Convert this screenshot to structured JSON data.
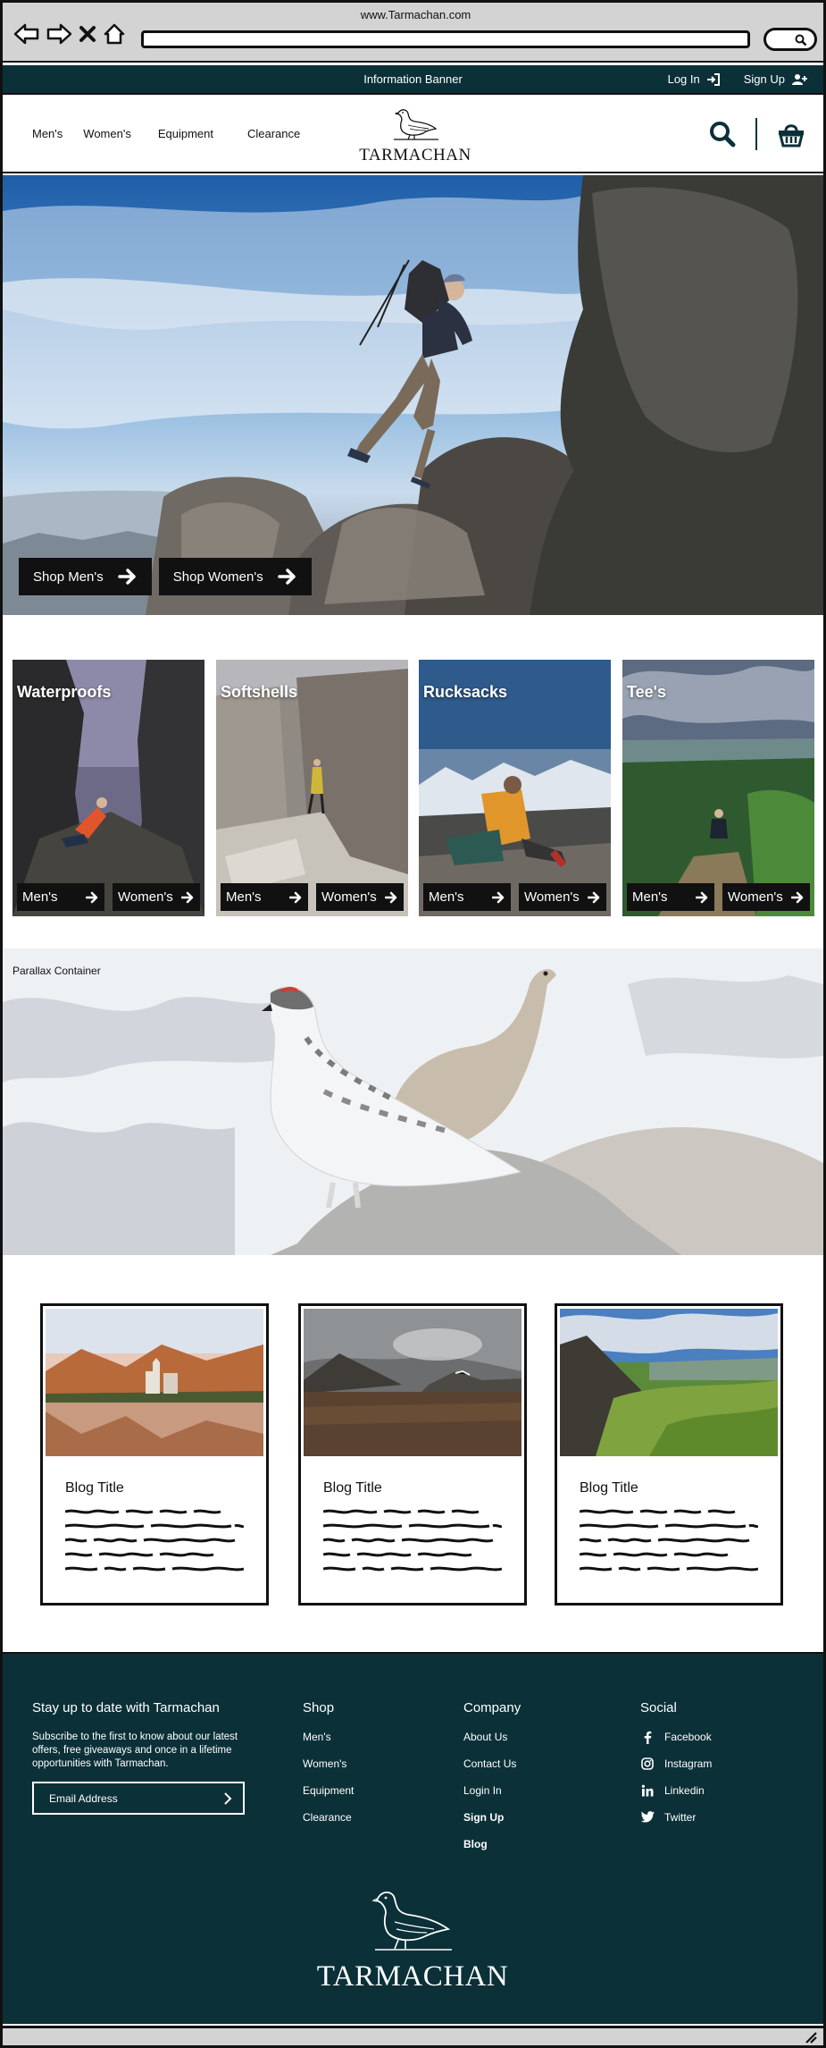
{
  "browser": {
    "url": "www.Tarmachan.com"
  },
  "banner": {
    "text": "Information Banner",
    "login": "Log In",
    "signup": "Sign Up"
  },
  "nav": {
    "mens": "Men's",
    "womens": "Women's",
    "equipment": "Equipment",
    "clearance": "Clearance"
  },
  "brand": {
    "name": "TARMACHAN"
  },
  "hero": {
    "shop_mens": "Shop Men's",
    "shop_womens": "Shop Women's"
  },
  "categories": [
    {
      "title": "Waterproofs",
      "mens": "Men's",
      "womens": "Women's"
    },
    {
      "title": "Softshells",
      "mens": "Men's",
      "womens": "Women's"
    },
    {
      "title": "Rucksacks",
      "mens": "Men's",
      "womens": "Women's"
    },
    {
      "title": "Tee's",
      "mens": "Men's",
      "womens": "Women's"
    }
  ],
  "parallax": {
    "label": "Parallax Container"
  },
  "blog": [
    {
      "title": "Blog Title"
    },
    {
      "title": "Blog Title"
    },
    {
      "title": "Blog Title"
    }
  ],
  "footer": {
    "newsletter_title": "Stay up to date with Tarmachan",
    "newsletter_text": "Subscribe to the first to know about our latest offers, free giveaways and once in a lifetime opportunities with Tarmachan.",
    "email_placeholder": "Email Address",
    "shop_title": "Shop",
    "shop_links": [
      "Men's",
      "Women's",
      "Equipment",
      "Clearance"
    ],
    "company_title": "Company",
    "company_links": [
      "About Us",
      "Contact Us",
      "Login In",
      "Sign Up",
      "Blog"
    ],
    "social_title": "Social",
    "social_links": [
      "Facebook",
      "Instagram",
      "Linkedin",
      "Twitter"
    ],
    "brand": "TARMACHAN"
  },
  "colors": {
    "primary": "#0b3038",
    "button": "#111111",
    "chrome": "#d3d3d3"
  },
  "icons": [
    "back-arrow-icon",
    "forward-arrow-icon",
    "close-icon",
    "home-icon",
    "search-icon",
    "login-icon",
    "add-user-icon",
    "basket-icon",
    "arrow-right-icon",
    "ptarmigan-logo",
    "facebook-icon",
    "instagram-icon",
    "linkedin-icon",
    "twitter-icon",
    "chevron-right-icon",
    "resize-grip-icon"
  ]
}
